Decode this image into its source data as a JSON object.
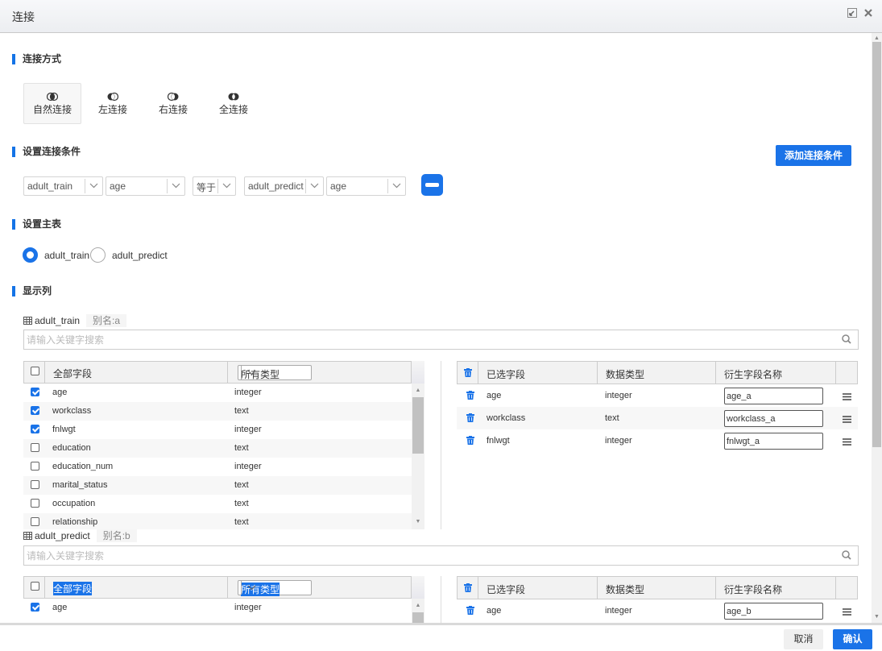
{
  "dialog": {
    "title": "连接",
    "restore_icon": "restore-window-icon",
    "close_icon": "close-icon"
  },
  "join_mode": {
    "section_title": "连接方式",
    "options": [
      {
        "label": "自然连接",
        "icon": "inner-join-icon",
        "active": true
      },
      {
        "label": "左连接",
        "icon": "left-join-icon",
        "active": false
      },
      {
        "label": "右连接",
        "icon": "right-join-icon",
        "active": false
      },
      {
        "label": "全连接",
        "icon": "full-join-icon",
        "active": false
      }
    ]
  },
  "conditions": {
    "section_title": "设置连接条件",
    "add_button": "添加连接条件",
    "rows": [
      {
        "left_table": "adult_train",
        "left_field": "age",
        "operator": "等于",
        "right_table": "adult_predict",
        "right_field": "age"
      }
    ]
  },
  "main_table": {
    "section_title": "设置主表",
    "options": [
      {
        "label": "adult_train",
        "checked": true
      },
      {
        "label": "adult_predict",
        "checked": false
      }
    ]
  },
  "display_columns": {
    "section_title": "显示列",
    "tables": [
      {
        "name": "adult_train",
        "alias": "别名:a",
        "search_placeholder": "请输入关键字搜索",
        "left_header": {
          "all_fields": "全部字段",
          "type_filter": "所有类型",
          "highlighted": false
        },
        "fields": [
          {
            "name": "age",
            "type": "integer",
            "checked": true
          },
          {
            "name": "workclass",
            "type": "text",
            "checked": true
          },
          {
            "name": "fnlwgt",
            "type": "integer",
            "checked": true
          },
          {
            "name": "education",
            "type": "text",
            "checked": false
          },
          {
            "name": "education_num",
            "type": "integer",
            "checked": false
          },
          {
            "name": "marital_status",
            "type": "text",
            "checked": false
          },
          {
            "name": "occupation",
            "type": "text",
            "checked": false
          },
          {
            "name": "relationship",
            "type": "text",
            "checked": false
          }
        ],
        "right_header": {
          "selected": "已选字段",
          "data_type": "数据类型",
          "derived_name": "衍生字段名称"
        },
        "selected": [
          {
            "name": "age",
            "type": "integer",
            "derived": "age_a"
          },
          {
            "name": "workclass",
            "type": "text",
            "derived": "workclass_a"
          },
          {
            "name": "fnlwgt",
            "type": "integer",
            "derived": "fnlwgt_a"
          }
        ]
      },
      {
        "name": "adult_predict",
        "alias": "别名:b",
        "search_placeholder": "请输入关键字搜索",
        "left_header": {
          "all_fields": "全部字段",
          "type_filter": "所有类型",
          "highlighted": true
        },
        "fields": [
          {
            "name": "age",
            "type": "integer",
            "checked": true
          }
        ],
        "right_header": {
          "selected": "已选字段",
          "data_type": "数据类型",
          "derived_name": "衍生字段名称"
        },
        "selected": [
          {
            "name": "age",
            "type": "integer",
            "derived": "age_b"
          }
        ]
      }
    ]
  },
  "footer": {
    "cancel": "取消",
    "confirm": "确认"
  },
  "colors": {
    "accent": "#1a73e8",
    "section_marker": "#1473e6"
  }
}
